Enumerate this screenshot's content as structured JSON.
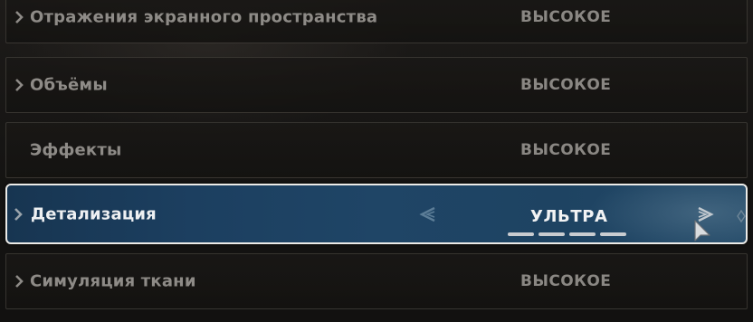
{
  "settings": {
    "rows": [
      {
        "label": "Отражения экранного пространства",
        "value": "ВЫСОКОЕ",
        "has_caret": true
      },
      {
        "label": "Объёмы",
        "value": "ВЫСОКОЕ",
        "has_caret": true
      },
      {
        "label": "Эффекты",
        "value": "ВЫСОКОЕ",
        "has_caret": false
      },
      {
        "label": "Детализация",
        "value": "УЛЬТРА",
        "has_caret": true,
        "selected": true,
        "level": 4,
        "levels": 4
      },
      {
        "label": "Симуляция ткани",
        "value": "ВЫСОКОЕ",
        "has_caret": true
      }
    ]
  },
  "icons": {
    "expand": "caret-right-icon",
    "prev": "arrow-left-icon",
    "next": "arrow-right-icon",
    "pointer": "mouse-cursor-icon"
  },
  "colors": {
    "selected_bg": "#1e4362",
    "selected_border": "#ecebe8",
    "text_dim": "#8b8884",
    "text_bright": "#eef0f2"
  }
}
